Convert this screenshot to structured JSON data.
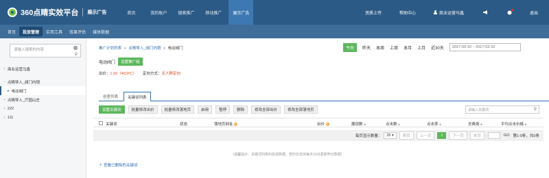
{
  "header": {
    "logo_text": "360点睛实效平台",
    "logo_sub": "展示广告",
    "nav": [
      "首页",
      "我的账户",
      "搜索推广",
      "移动推广",
      "展示广告"
    ],
    "right": {
      "upload": "资质上传",
      "help": "帮助中心",
      "user": "商业运营马鑫",
      "logout": "退出"
    }
  },
  "subnav": [
    "首页",
    "投放管理",
    "实用工具",
    "效果评估",
    "媒体数据"
  ],
  "sidebar": {
    "search_placeholder": "请输入搜索的内容",
    "tree": [
      "商业运营马鑫",
      "点睛导入_阀门内销",
      "电动阀门",
      "点睛导入_厅园山庄",
      "222",
      "111"
    ]
  },
  "breadcrumb": {
    "l1": "推广计划列表",
    "l2": "点睛导入_阀门内销",
    "l3": "电动阀门",
    "sep": ">"
  },
  "date_filters": [
    "今天",
    "昨天",
    "本周",
    "上周",
    "本月",
    "上月",
    "近30天"
  ],
  "date_range": "2017-03-10 ~ 2017-03-10",
  "adgroup": {
    "name": "电动阀门",
    "set_button": "设置推广组",
    "bid_label": "出价：",
    "bid_value": "1.50（¥/CPC）",
    "targeting_label": "定向方式：",
    "targeting_value": "无人群定向"
  },
  "tabs": [
    "创意列表",
    "关键词列表"
  ],
  "toolbar": [
    "设置关键词",
    "批量修改出价",
    "批量修改落地页",
    "启用",
    "暂停",
    "删除",
    "修改全部出价",
    "修改全部落地页"
  ],
  "keyword_search_placeholder": "请输入关键词",
  "table": {
    "columns": [
      "关键词",
      "状态",
      "落地页网址",
      "出价",
      "展现数",
      "点击数",
      "点击率",
      "总费用",
      "平均点击价格"
    ]
  },
  "pager": {
    "per_page_label": "每页显示数量：",
    "per_page": "25",
    "first": "首页",
    "prev": "上一页",
    "current": "1",
    "next": "下一页",
    "last": "末页",
    "go": "GO",
    "summary": "第1-0条，共0条"
  },
  "note": "（温馨提示：关键词列表的投放数据，暂时仅支持每天10点更新昨日数据）",
  "deleted_link": "＋ 查看已删除的关键词",
  "colors": {
    "header_bg": "#2c5a86",
    "accent_green": "#5cb85c",
    "link_blue": "#2c6bb5",
    "red": "#e04a1f"
  }
}
